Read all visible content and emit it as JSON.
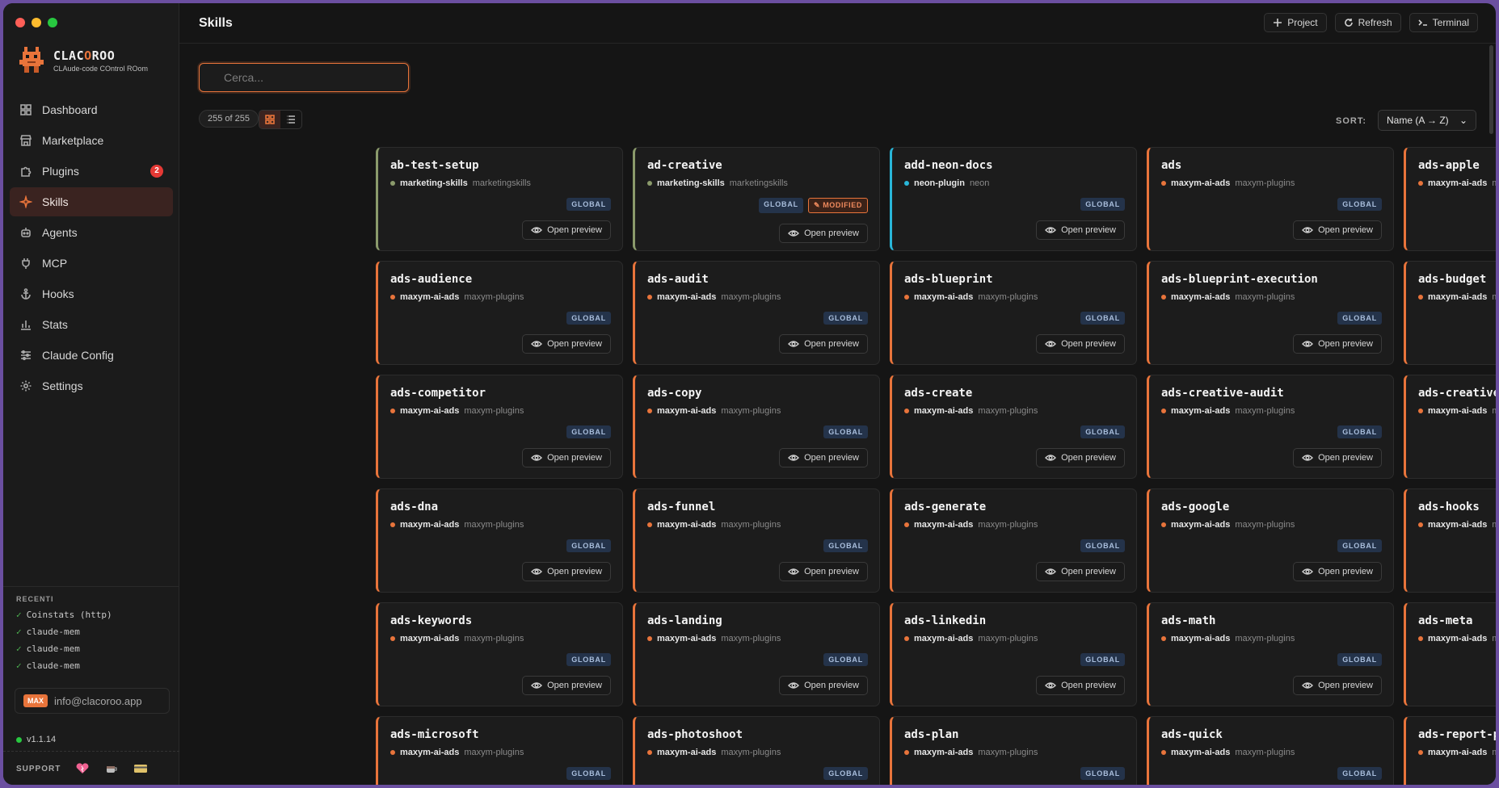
{
  "app": {
    "name_prefix": "CLAC",
    "name_o": "O",
    "name_suffix": "ROO",
    "subtitle": "CLAude-code COntrol ROom"
  },
  "sidebar": {
    "items": [
      {
        "label": "Dashboard",
        "icon": "dashboard-icon"
      },
      {
        "label": "Marketplace",
        "icon": "store-icon"
      },
      {
        "label": "Plugins",
        "icon": "puzzle-icon",
        "badge": "2"
      },
      {
        "label": "Skills",
        "icon": "sparkle-icon",
        "active": true
      },
      {
        "label": "Agents",
        "icon": "bot-icon"
      },
      {
        "label": "MCP",
        "icon": "plug-icon"
      },
      {
        "label": "Hooks",
        "icon": "anchor-icon"
      },
      {
        "label": "Stats",
        "icon": "bar-chart-icon"
      },
      {
        "label": "Claude Config",
        "icon": "sliders-icon"
      },
      {
        "label": "Settings",
        "icon": "gear-icon"
      }
    ],
    "recent_title": "RECENTI",
    "recent": [
      "Coinstats (http)",
      "claude-mem",
      "claude-mem",
      "claude-mem"
    ],
    "plan_badge": "MAX",
    "email": "info@clacoroo.app",
    "version": "v1.1.14",
    "support_label": "SUPPORT"
  },
  "header": {
    "title": "Skills",
    "actions": [
      {
        "label": "Project",
        "icon": "plus-icon"
      },
      {
        "label": "Refresh",
        "icon": "refresh-icon"
      },
      {
        "label": "Terminal",
        "icon": "terminal-icon"
      }
    ]
  },
  "toolbar": {
    "search_placeholder": "Cerca...",
    "count": "255 of 255",
    "sort_label": "SORT:",
    "sort_value": "Name (A → Z)"
  },
  "colors": {
    "accent": "#e8743b",
    "marketingskills": "#8a9a6b",
    "neon": "#29b6d8"
  },
  "card_labels": {
    "global": "GLOBAL",
    "modified": "MODIFIED",
    "preview": "Open preview"
  },
  "skills": [
    {
      "name": "ab-test-setup",
      "plugin": "marketing-skills",
      "marketplace": "marketingskills",
      "color": "#8a9a6b"
    },
    {
      "name": "ad-creative",
      "plugin": "marketing-skills",
      "marketplace": "marketingskills",
      "color": "#8a9a6b",
      "modified": true
    },
    {
      "name": "add-neon-docs",
      "plugin": "neon-plugin",
      "marketplace": "neon",
      "color": "#29b6d8"
    },
    {
      "name": "ads",
      "plugin": "maxym-ai-ads",
      "marketplace": "maxym-plugins",
      "color": "#e8743b"
    },
    {
      "name": "ads-apple",
      "plugin": "maxym-ai-ads",
      "marketplace": "maxym-plugins",
      "color": "#e8743b"
    },
    {
      "name": "ads-audience",
      "plugin": "maxym-ai-ads",
      "marketplace": "maxym-plugins",
      "color": "#e8743b"
    },
    {
      "name": "ads-audit",
      "plugin": "maxym-ai-ads",
      "marketplace": "maxym-plugins",
      "color": "#e8743b"
    },
    {
      "name": "ads-blueprint",
      "plugin": "maxym-ai-ads",
      "marketplace": "maxym-plugins",
      "color": "#e8743b"
    },
    {
      "name": "ads-blueprint-execution",
      "plugin": "maxym-ai-ads",
      "marketplace": "maxym-plugins",
      "color": "#e8743b"
    },
    {
      "name": "ads-budget",
      "plugin": "maxym-ai-ads",
      "marketplace": "maxym-plugins",
      "color": "#e8743b"
    },
    {
      "name": "ads-competitor",
      "plugin": "maxym-ai-ads",
      "marketplace": "maxym-plugins",
      "color": "#e8743b"
    },
    {
      "name": "ads-copy",
      "plugin": "maxym-ai-ads",
      "marketplace": "maxym-plugins",
      "color": "#e8743b"
    },
    {
      "name": "ads-create",
      "plugin": "maxym-ai-ads",
      "marketplace": "maxym-plugins",
      "color": "#e8743b"
    },
    {
      "name": "ads-creative-audit",
      "plugin": "maxym-ai-ads",
      "marketplace": "maxym-plugins",
      "color": "#e8743b"
    },
    {
      "name": "ads-creative-brief",
      "plugin": "maxym-ai-ads",
      "marketplace": "maxym-plugins",
      "color": "#e8743b"
    },
    {
      "name": "ads-dna",
      "plugin": "maxym-ai-ads",
      "marketplace": "maxym-plugins",
      "color": "#e8743b"
    },
    {
      "name": "ads-funnel",
      "plugin": "maxym-ai-ads",
      "marketplace": "maxym-plugins",
      "color": "#e8743b"
    },
    {
      "name": "ads-generate",
      "plugin": "maxym-ai-ads",
      "marketplace": "maxym-plugins",
      "color": "#e8743b"
    },
    {
      "name": "ads-google",
      "plugin": "maxym-ai-ads",
      "marketplace": "maxym-plugins",
      "color": "#e8743b"
    },
    {
      "name": "ads-hooks",
      "plugin": "maxym-ai-ads",
      "marketplace": "maxym-plugins",
      "color": "#e8743b"
    },
    {
      "name": "ads-keywords",
      "plugin": "maxym-ai-ads",
      "marketplace": "maxym-plugins",
      "color": "#e8743b"
    },
    {
      "name": "ads-landing",
      "plugin": "maxym-ai-ads",
      "marketplace": "maxym-plugins",
      "color": "#e8743b"
    },
    {
      "name": "ads-linkedin",
      "plugin": "maxym-ai-ads",
      "marketplace": "maxym-plugins",
      "color": "#e8743b"
    },
    {
      "name": "ads-math",
      "plugin": "maxym-ai-ads",
      "marketplace": "maxym-plugins",
      "color": "#e8743b"
    },
    {
      "name": "ads-meta",
      "plugin": "maxym-ai-ads",
      "marketplace": "maxym-plugins",
      "color": "#e8743b"
    },
    {
      "name": "ads-microsoft",
      "plugin": "maxym-ai-ads",
      "marketplace": "maxym-plugins",
      "color": "#e8743b"
    },
    {
      "name": "ads-photoshoot",
      "plugin": "maxym-ai-ads",
      "marketplace": "maxym-plugins",
      "color": "#e8743b"
    },
    {
      "name": "ads-plan",
      "plugin": "maxym-ai-ads",
      "marketplace": "maxym-plugins",
      "color": "#e8743b"
    },
    {
      "name": "ads-quick",
      "plugin": "maxym-ai-ads",
      "marketplace": "maxym-plugins",
      "color": "#e8743b"
    },
    {
      "name": "ads-report-pdf",
      "plugin": "maxym-ai-ads",
      "marketplace": "maxym-plugins",
      "color": "#e8743b"
    }
  ]
}
